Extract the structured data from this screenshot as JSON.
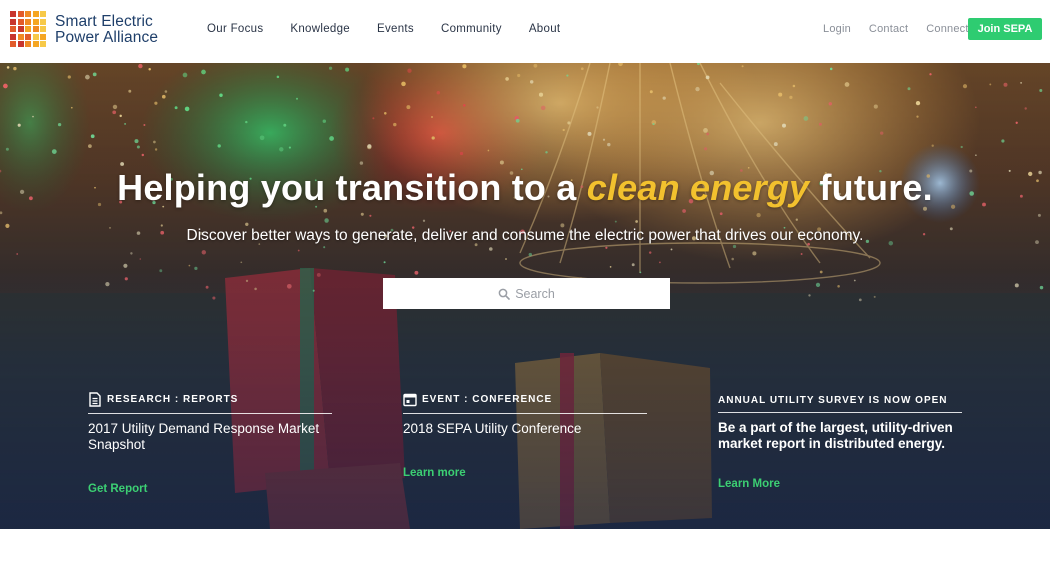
{
  "colors": {
    "accent": "#2ecc71",
    "link_green": "#3ccf73",
    "highlight_yellow": "#f2c12e",
    "navy": "#1f3f6a",
    "logo_squares": [
      "#c8352d",
      "#e25b2a",
      "#f08a24",
      "#f5a623",
      "#f7c948"
    ]
  },
  "header": {
    "logo": {
      "line1": "Smart Electric",
      "line2": "Power Alliance",
      "icon": "grid-squares-logo"
    },
    "nav": [
      {
        "label": "Our Focus"
      },
      {
        "label": "Knowledge"
      },
      {
        "label": "Events"
      },
      {
        "label": "Community"
      },
      {
        "label": "About"
      }
    ],
    "utility": [
      {
        "label": "Login"
      },
      {
        "label": "Contact"
      },
      {
        "label": "Connect"
      }
    ],
    "cta": "Join SEPA"
  },
  "hero": {
    "title_pre": "Helping you transition to a ",
    "title_em": "clean energy",
    "title_post": " future.",
    "subtitle": "Discover better ways to generate, deliver and consume the electric power that drives our economy.",
    "search": {
      "placeholder": "Search",
      "icon": "search-icon"
    }
  },
  "features": [
    {
      "icon": "document-icon",
      "category": "RESEARCH : REPORTS",
      "title": "2017 Utility Demand Response Market Snapshot",
      "link": "Get Report"
    },
    {
      "icon": "calendar-icon",
      "category": "EVENT : CONFERENCE",
      "title": "2018 SEPA Utility Conference",
      "link": "Learn more"
    },
    {
      "icon": "",
      "category": "ANNUAL UTILITY SURVEY IS NOW OPEN",
      "title": "Be a part of the largest, utility-driven market report in distributed energy.",
      "link": "Learn More"
    }
  ]
}
